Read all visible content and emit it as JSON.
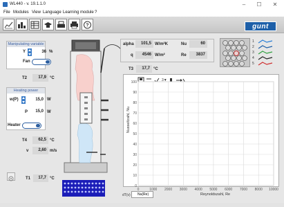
{
  "window": {
    "title": "WL440 - v. 19.1.1.0",
    "controls": [
      "–",
      "☐",
      "✕"
    ]
  },
  "menu": [
    "File",
    "Modules",
    "View",
    "Language",
    "Learning module",
    "?"
  ],
  "toolbar": {
    "icons": [
      "diagram-icon",
      "bars-icon",
      "table-icon",
      "graduation-icon",
      "print-setup-icon",
      "print-icon",
      "help-icon"
    ],
    "logo": "gunt"
  },
  "manipulating": {
    "title": "Manipulating variable",
    "y_label": "Y",
    "y_value": "36",
    "y_unit": "%",
    "fan_label": "Fan"
  },
  "t2": {
    "label": "T2",
    "value": "17,9",
    "unit": "°C"
  },
  "heating": {
    "title": "Heating power",
    "wp_label": "w(P)",
    "wp_value": "15,0",
    "wp_unit": "W",
    "p_label": "P",
    "p_value": "15,0",
    "p_unit": "W",
    "heater_label": "Heater"
  },
  "t4": {
    "label": "T4",
    "value": "62,5",
    "unit": "°C"
  },
  "v": {
    "label": "v",
    "value": "2,60",
    "unit": "m/s"
  },
  "t1": {
    "label": "T1",
    "value": "17,7",
    "unit": "°C"
  },
  "alpha": {
    "label": "alpha",
    "value": "101,5",
    "unit": "W/m²K"
  },
  "q": {
    "label": "q",
    "value": "4546",
    "unit": "W/m²"
  },
  "nu": {
    "label": "Nu",
    "value": "60"
  },
  "re": {
    "label": "Re",
    "value": "3837"
  },
  "t3": {
    "label": "T3",
    "value": "17,7",
    "unit": "°C"
  },
  "config_rows": [
    "1",
    "2",
    "3",
    "4",
    "5"
  ],
  "chart": {
    "xlabel": "Reynoldszahl, Re",
    "ylabel": "Nusseltzahl, Nu",
    "xticks": [
      "0",
      "1000",
      "2000",
      "3000",
      "4000",
      "5000",
      "6000",
      "7000",
      "8000",
      "10000"
    ],
    "yticks": [
      "0",
      "10",
      "20",
      "30",
      "40",
      "50",
      "60",
      "70",
      "80",
      "90",
      "100"
    ],
    "selector": "Nu(Re)",
    "selector_prefix": "dT(v)"
  }
}
